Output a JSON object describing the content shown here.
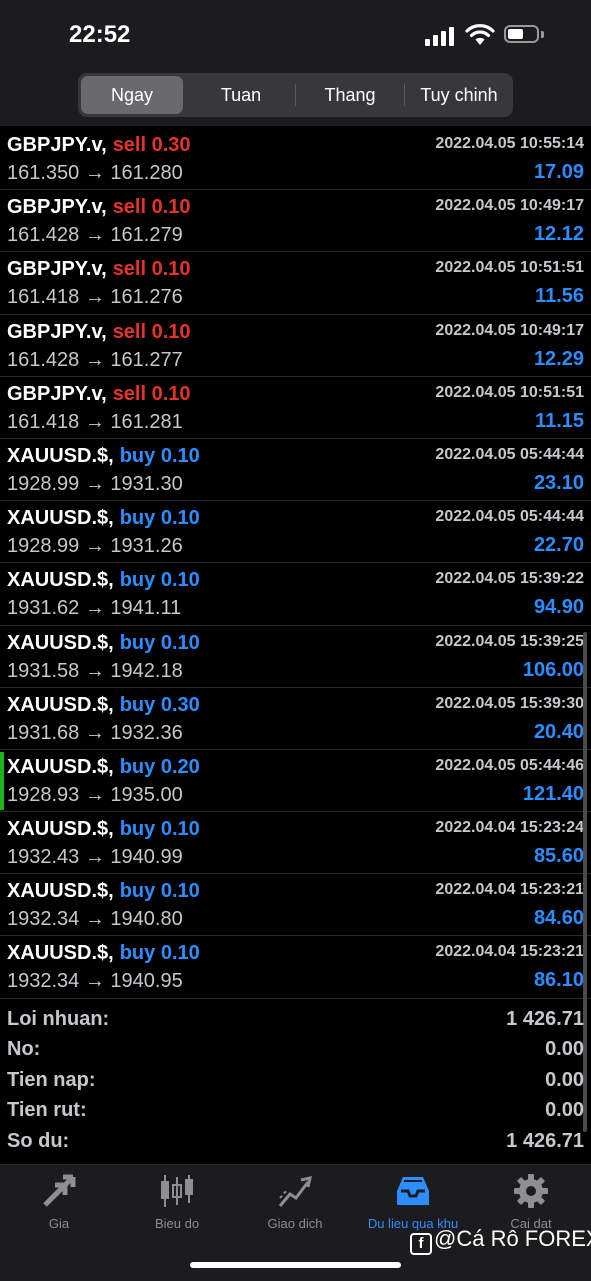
{
  "status_bar": {
    "time": "22:52"
  },
  "tabs": {
    "items": [
      "Ngay",
      "Tuan",
      "Thang",
      "Tuy chinh"
    ],
    "active": "Ngay"
  },
  "trades": [
    {
      "symbol": "GBPJPY.v,",
      "side": "sell",
      "lots": "0.30",
      "timestamp": "2022.04.05 10:55:14",
      "price_open": "161.350",
      "price_close": "161.280",
      "profit": "17.09",
      "marked": false
    },
    {
      "symbol": "GBPJPY.v,",
      "side": "sell",
      "lots": "0.10",
      "timestamp": "2022.04.05 10:49:17",
      "price_open": "161.428",
      "price_close": "161.279",
      "profit": "12.12",
      "marked": false
    },
    {
      "symbol": "GBPJPY.v,",
      "side": "sell",
      "lots": "0.10",
      "timestamp": "2022.04.05 10:51:51",
      "price_open": "161.418",
      "price_close": "161.276",
      "profit": "11.56",
      "marked": false
    },
    {
      "symbol": "GBPJPY.v,",
      "side": "sell",
      "lots": "0.10",
      "timestamp": "2022.04.05 10:49:17",
      "price_open": "161.428",
      "price_close": "161.277",
      "profit": "12.29",
      "marked": false
    },
    {
      "symbol": "GBPJPY.v,",
      "side": "sell",
      "lots": "0.10",
      "timestamp": "2022.04.05 10:51:51",
      "price_open": "161.418",
      "price_close": "161.281",
      "profit": "11.15",
      "marked": false
    },
    {
      "symbol": "XAUUSD.$,",
      "side": "buy",
      "lots": "0.10",
      "timestamp": "2022.04.05 05:44:44",
      "price_open": "1928.99",
      "price_close": "1931.30",
      "profit": "23.10",
      "marked": false
    },
    {
      "symbol": "XAUUSD.$,",
      "side": "buy",
      "lots": "0.10",
      "timestamp": "2022.04.05 05:44:44",
      "price_open": "1928.99",
      "price_close": "1931.26",
      "profit": "22.70",
      "marked": false
    },
    {
      "symbol": "XAUUSD.$,",
      "side": "buy",
      "lots": "0.10",
      "timestamp": "2022.04.05 15:39:22",
      "price_open": "1931.62",
      "price_close": "1941.11",
      "profit": "94.90",
      "marked": false
    },
    {
      "symbol": "XAUUSD.$,",
      "side": "buy",
      "lots": "0.10",
      "timestamp": "2022.04.05 15:39:25",
      "price_open": "1931.58",
      "price_close": "1942.18",
      "profit": "106.00",
      "marked": false
    },
    {
      "symbol": "XAUUSD.$,",
      "side": "buy",
      "lots": "0.30",
      "timestamp": "2022.04.05 15:39:30",
      "price_open": "1931.68",
      "price_close": "1932.36",
      "profit": "20.40",
      "marked": false
    },
    {
      "symbol": "XAUUSD.$,",
      "side": "buy",
      "lots": "0.20",
      "timestamp": "2022.04.05 05:44:46",
      "price_open": "1928.93",
      "price_close": "1935.00",
      "profit": "121.40",
      "marked": true
    },
    {
      "symbol": "XAUUSD.$,",
      "side": "buy",
      "lots": "0.10",
      "timestamp": "2022.04.04 15:23:24",
      "price_open": "1932.43",
      "price_close": "1940.99",
      "profit": "85.60",
      "marked": false
    },
    {
      "symbol": "XAUUSD.$,",
      "side": "buy",
      "lots": "0.10",
      "timestamp": "2022.04.04 15:23:21",
      "price_open": "1932.34",
      "price_close": "1940.80",
      "profit": "84.60",
      "marked": false
    },
    {
      "symbol": "XAUUSD.$,",
      "side": "buy",
      "lots": "0.10",
      "timestamp": "2022.04.04 15:23:21",
      "price_open": "1932.34",
      "price_close": "1940.95",
      "profit": "86.10",
      "marked": false
    }
  ],
  "arrow": "→",
  "summary": [
    {
      "label": "Loi nhuan:",
      "value": "1 426.71"
    },
    {
      "label": "No:",
      "value": "0.00"
    },
    {
      "label": "Tien nap:",
      "value": "0.00"
    },
    {
      "label": "Tien rut:",
      "value": "0.00"
    },
    {
      "label": "So du:",
      "value": "1 426.71"
    }
  ],
  "bottom_nav": [
    {
      "label": "Gia",
      "icon": "quotes-arrows-icon",
      "active": false
    },
    {
      "label": "Bieu do",
      "icon": "candlestick-chart-icon",
      "active": false
    },
    {
      "label": "Giao dich",
      "icon": "trade-line-icon",
      "active": false
    },
    {
      "label": "Du lieu qua khu",
      "icon": "history-inbox-icon",
      "active": true
    },
    {
      "label": "Cai dat",
      "icon": "gear-icon",
      "active": false
    }
  ],
  "watermark": {
    "fb_glyph": "f",
    "text": "@Cá Rô FOREX"
  },
  "colors": {
    "sell": "#e5332b",
    "buy": "#2c8dff",
    "profit": "#2c8dff",
    "marker": "#1fb21f"
  }
}
